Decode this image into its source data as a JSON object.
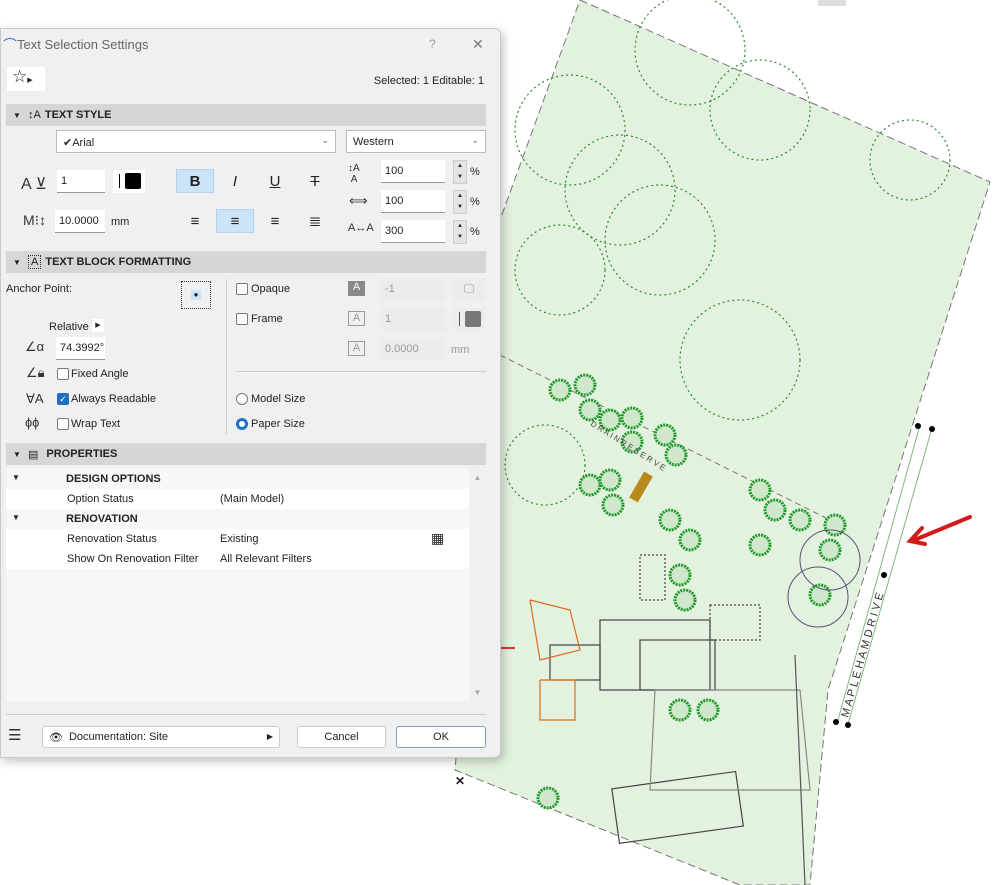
{
  "dialog": {
    "title": "Text Selection Settings",
    "help": "?",
    "close": "✕",
    "selection_info": "Selected: 1 Editable: 1"
  },
  "text_style": {
    "header": "TEXT STYLE",
    "font": "✔Arial",
    "script": "Western",
    "pen": "1",
    "size": "10.0000",
    "size_unit": "mm",
    "line_spacing": "100",
    "width_factor": "100",
    "char_spacing": "300",
    "percent": "%",
    "bold": "B",
    "italic": "I",
    "underline": "U",
    "strike": "T"
  },
  "text_block": {
    "header": "TEXT BLOCK FORMATTING",
    "anchor_label": "Anchor Point:",
    "relative": "Relative",
    "angle": "74.3992°",
    "fixed_angle": "Fixed Angle",
    "always_readable": "Always Readable",
    "wrap_text": "Wrap Text",
    "opaque": "Opaque",
    "frame": "Frame",
    "opaque_pen": "-1",
    "frame_pen": "1",
    "frame_offset": "0.0000",
    "offset_unit": "mm",
    "model_size": "Model Size",
    "paper_size": "Paper Size",
    "always_readable_checked": true,
    "paper_size_selected": true
  },
  "properties": {
    "header": "PROPERTIES",
    "groups": [
      {
        "name": "DESIGN OPTIONS",
        "rows": [
          {
            "label": "Option Status",
            "value": "(Main Model)"
          }
        ]
      },
      {
        "name": "RENOVATION",
        "rows": [
          {
            "label": "Renovation Status",
            "value": "Existing"
          },
          {
            "label": "Show On Renovation Filter",
            "value": "All Relevant Filters"
          }
        ]
      }
    ]
  },
  "footer": {
    "layer": "Documentation: Site",
    "cancel": "Cancel",
    "ok": "OK"
  },
  "map": {
    "street_label": "M A P L E H A M   D R I V E",
    "drain_label": "D R A I N   R E S E R V E",
    "close_mark": "✕"
  },
  "colors": {
    "accent": "#1f6fc5",
    "site_green": "#e3f2df",
    "tree": "#1e9a2a",
    "arrow": "#d41a1a"
  }
}
